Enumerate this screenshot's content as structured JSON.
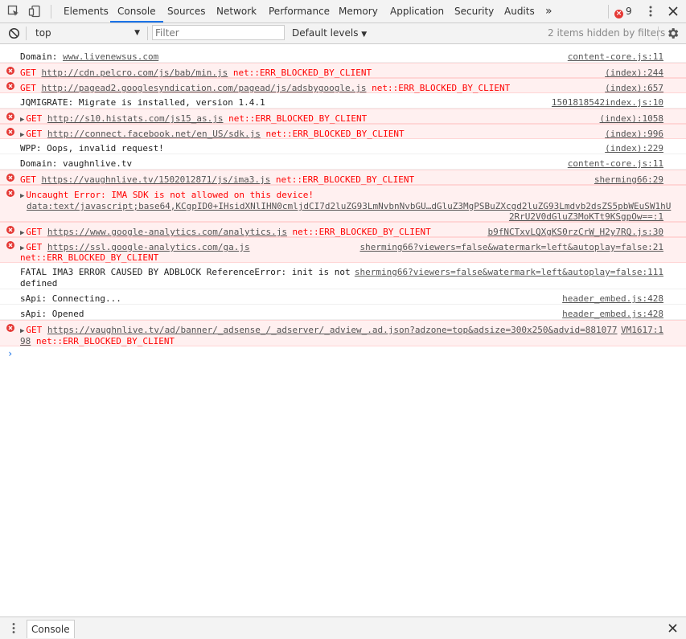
{
  "tabs": [
    "Elements",
    "Console",
    "Sources",
    "Network",
    "Performance",
    "Memory",
    "Application",
    "Security",
    "Audits"
  ],
  "active_tab": "Console",
  "more_tabs_glyph": "»",
  "error_count": "9",
  "toolbar": {
    "context": "top",
    "filter_placeholder": "Filter",
    "levels": "Default levels",
    "hidden_note": "2 items hidden by filters"
  },
  "messages": [
    {
      "level": "log",
      "text": "Domain: ",
      "link": "www.livenewsus.com",
      "rest": "",
      "source": "content-core.js:11"
    },
    {
      "level": "error",
      "expand": false,
      "prefix": "GET ",
      "link": "http://cdn.pelcro.com/js/bab/min.js",
      "rest": " net::ERR_BLOCKED_BY_CLIENT",
      "source": "(index):244"
    },
    {
      "level": "error",
      "expand": false,
      "prefix": "GET ",
      "link": "http://pagead2.googlesyndication.com/pagead/js/adsbygoogle.js",
      "rest": " net::ERR_BLOCKED_BY_CLIENT",
      "source": "(index):657"
    },
    {
      "level": "log",
      "text": "JQMIGRATE: Migrate is installed, version 1.4.1",
      "link": "",
      "rest": "",
      "source": "1501818542index.js:10"
    },
    {
      "level": "error",
      "expand": true,
      "prefix": "GET ",
      "link": "http://s10.histats.com/js15_as.js",
      "rest": " net::ERR_BLOCKED_BY_CLIENT",
      "source": "(index):1058"
    },
    {
      "level": "error",
      "expand": true,
      "prefix": "GET ",
      "link": "http://connect.facebook.net/en_US/sdk.js",
      "rest": " net::ERR_BLOCKED_BY_CLIENT",
      "source": "(index):996"
    },
    {
      "level": "log",
      "text": "WPP: Oops, invalid request!",
      "link": "",
      "rest": "",
      "source": "(index):229"
    },
    {
      "level": "log",
      "text": "Domain: vaughnlive.tv",
      "link": "",
      "rest": "",
      "source": "content-core.js:11"
    },
    {
      "level": "error",
      "expand": false,
      "prefix": "GET ",
      "link": "https://vaughnlive.tv/1502012871/js/ima3.js",
      "rest": " net::ERR_BLOCKED_BY_CLIENT",
      "source": "sherming66:29"
    },
    {
      "level": "error",
      "expand": true,
      "prefix": "Uncaught Error: IMA SDK is not allowed on this device!",
      "line2": "data:text/javascript;base64,KCgpID0+IHsidXNlIHN0cmljdCI7d2luZG93LmNvbnNvbGU…dGluZ3MgPSBuZXcgd2luZG93Lmdvb2dsZS5pbWEuSW1hU",
      "line3": "2RrU2V0dGluZ3MoKTt9KSgpOw==:1"
    },
    {
      "level": "error",
      "expand": true,
      "prefix": "GET ",
      "link": "https://www.google-analytics.com/analytics.js",
      "rest": " net::ERR_BLOCKED_BY_CLIENT",
      "source": "b9fNCTxvLQXgKS0rzCrW_H2y7RQ.js:30"
    },
    {
      "level": "error",
      "expand": true,
      "prefix": "GET ",
      "link": "https://ssl.google-analytics.com/ga.js",
      "rest": "",
      "line2": "net::ERR_BLOCKED_BY_CLIENT",
      "source": "sherming66?viewers=false&watermark=left&autoplay=false:21"
    },
    {
      "level": "log",
      "text": "FATAL IMA3 ERROR CAUSED BY ADBLOCK ReferenceError: init is not",
      "line2": "defined",
      "source": "sherming66?viewers=false&watermark=left&autoplay=false:111"
    },
    {
      "level": "log",
      "text": "sApi: Connecting...",
      "source": "header_embed.js:428"
    },
    {
      "level": "log",
      "text": "sApi: Opened",
      "source": "header_embed.js:428"
    },
    {
      "level": "error",
      "expand": true,
      "prefix": "GET ",
      "link": "https://vaughnlive.tv/ad/banner/_adsense_/_adserver/_adview_.ad.json?adzone=top&adsize=300x250&advid=881077",
      "source": "VM1617:1",
      "line2_link": "98",
      "line2": " net::ERR_BLOCKED_BY_CLIENT"
    }
  ],
  "prompt_glyph": "›",
  "drawer": {
    "tab": "Console"
  },
  "colors": {
    "error_bg": "#fff0f0",
    "error_text": "#ff0000",
    "accent": "#1a73e8"
  }
}
